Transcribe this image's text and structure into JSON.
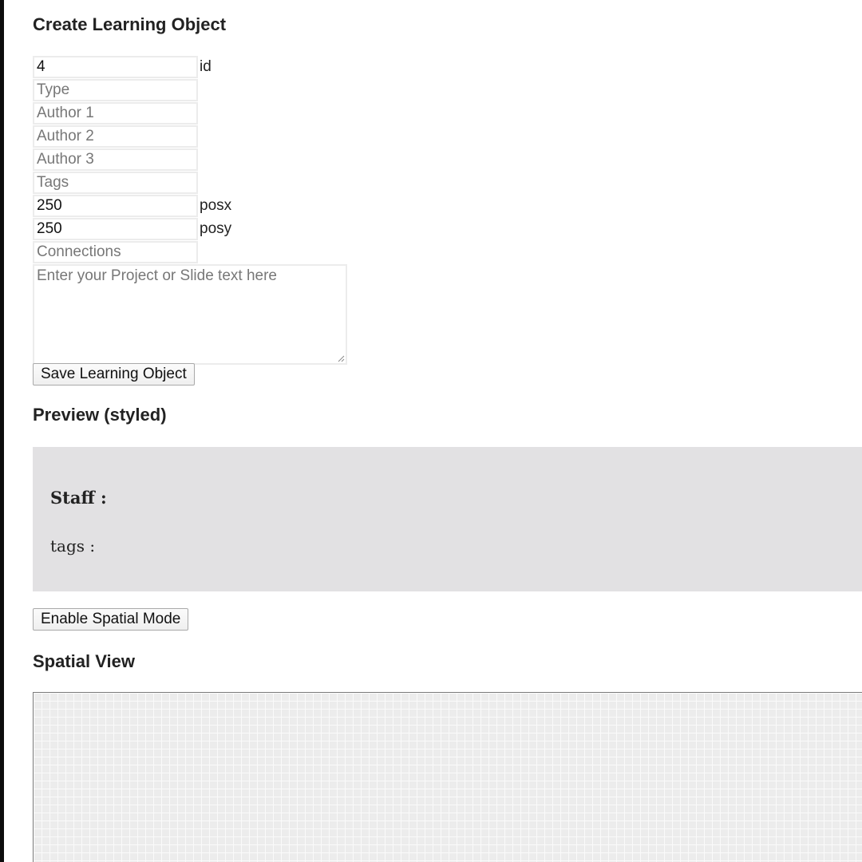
{
  "form": {
    "title": "Create Learning Object",
    "fields": [
      {
        "value": "4",
        "placeholder": "",
        "label": "id"
      },
      {
        "value": "",
        "placeholder": "Type",
        "label": ""
      },
      {
        "value": "",
        "placeholder": "Author 1",
        "label": ""
      },
      {
        "value": "",
        "placeholder": "Author 2",
        "label": ""
      },
      {
        "value": "",
        "placeholder": "Author 3",
        "label": ""
      },
      {
        "value": "",
        "placeholder": "Tags",
        "label": ""
      },
      {
        "value": "250",
        "placeholder": "",
        "label": "posx"
      },
      {
        "value": "250",
        "placeholder": "",
        "label": "posy"
      },
      {
        "value": "",
        "placeholder": "Connections",
        "label": ""
      }
    ],
    "text_placeholder": "Enter your Project or Slide text here",
    "save_label": "Save Learning Object"
  },
  "preview": {
    "title": "Preview (styled)",
    "staff_label": "Staff :",
    "tags_label": "tags :"
  },
  "spatial": {
    "enable_label": "Enable Spatial Mode",
    "title": "Spatial View"
  }
}
